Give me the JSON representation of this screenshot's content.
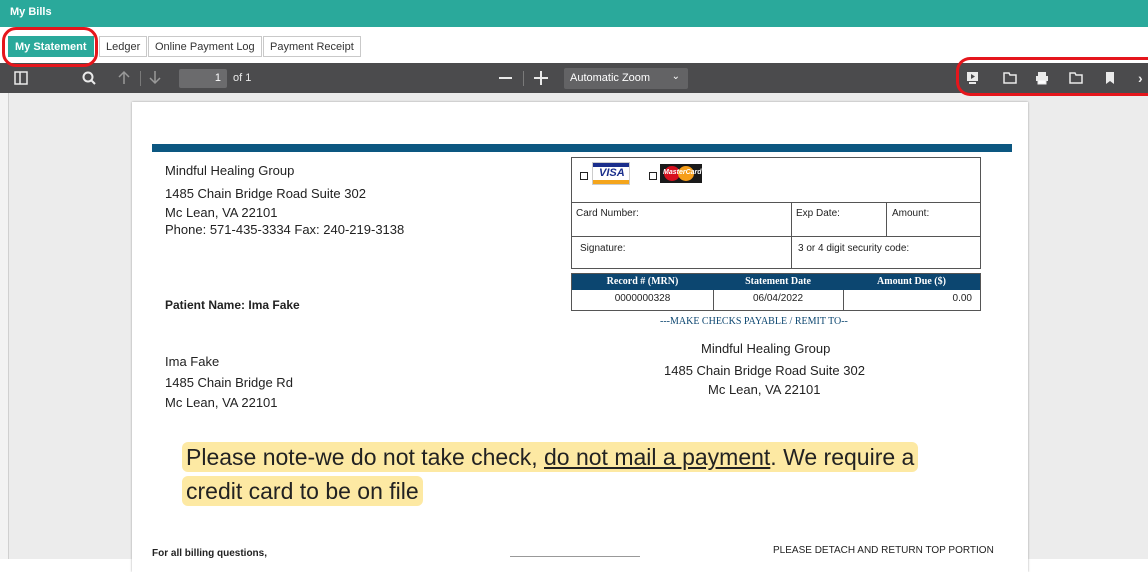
{
  "window": {
    "title": "My Bills"
  },
  "tabs": [
    {
      "label": "My Statement",
      "active": true
    },
    {
      "label": "Ledger",
      "active": false
    },
    {
      "label": "Online Payment Log",
      "active": false
    },
    {
      "label": "Payment Receipt",
      "active": false
    }
  ],
  "viewer": {
    "page_current": "1",
    "page_total": "of 1",
    "zoom": "Automatic Zoom",
    "icons": [
      "sidebar-toggle-icon",
      "search-icon",
      "arrow-up-icon",
      "arrow-down-icon",
      "minus-icon",
      "plus-icon",
      "presentation-icon",
      "open-file-icon",
      "print-icon",
      "download-icon",
      "bookmark-icon",
      "more-icon"
    ]
  },
  "statement": {
    "practice": {
      "name": "Mindful Healing Group",
      "address1": "1485 Chain Bridge Road Suite 302",
      "city": "Mc Lean, VA 22101",
      "phone": "Phone: 571-435-3334 Fax: 240-219-3138"
    },
    "patient_label": "Patient Name: Ima Fake",
    "patient": {
      "name": "Ima Fake",
      "address1": "1485 Chain Bridge Rd",
      "city": "Mc Lean, VA 22101"
    },
    "card_form": {
      "visa": "VISA",
      "mastercard": "MasterCard",
      "card_number": "Card Number:",
      "exp_date": "Exp Date:",
      "amount": "Amount:",
      "signature": "Signature:",
      "security_code": "3 or 4 digit security code:"
    },
    "record_table": {
      "headers": [
        "Record # (MRN)",
        "Statement Date",
        "Amount Due ($)"
      ],
      "values": [
        "0000000328",
        "06/04/2022",
        "0.00"
      ]
    },
    "remit_label": "---MAKE CHECKS PAYABLE / REMIT TO--",
    "remit": {
      "name": "Mindful Healing Group",
      "address1": "1485 Chain Bridge Road Suite 302",
      "city": "Mc Lean, VA 22101"
    },
    "footer_left": "For all billing questions,",
    "footer_right": "PLEASE DETACH AND RETURN TOP PORTION"
  },
  "note": {
    "part1": "Please note-we do not take check, ",
    "underlined": "do not mail a payment",
    "part2": ". We require a credit card  to be on file"
  },
  "colors": {
    "header_teal": "#2aa99b",
    "toolbar": "#4b4b4d",
    "statement_blue": "#0c5781",
    "highlight": "#fde9a3",
    "annotation_red": "#e5161c"
  }
}
